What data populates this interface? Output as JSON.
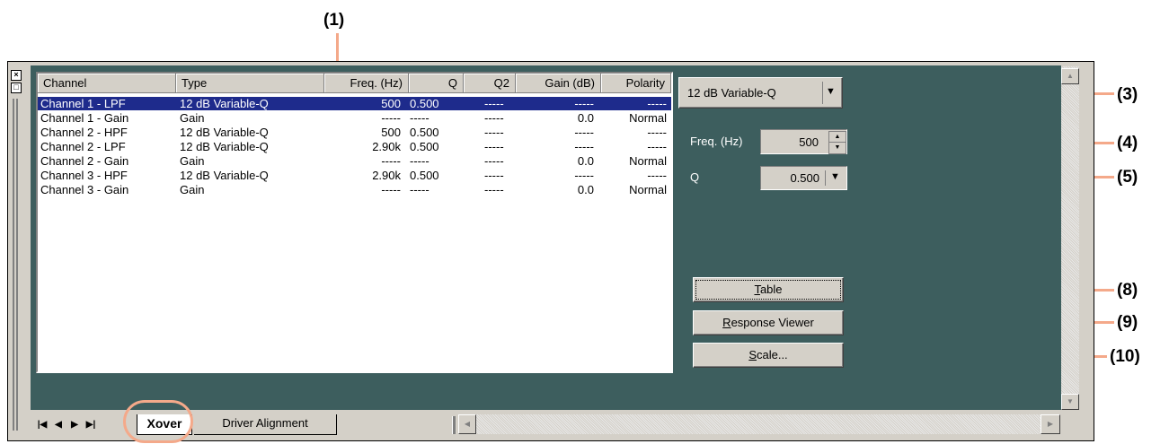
{
  "callouts": {
    "c1": "(1)",
    "c3": "(3)",
    "c4": "(4)",
    "c5": "(5)",
    "c8": "(8)",
    "c9": "(9)",
    "c10": "(10)"
  },
  "list": {
    "headers": [
      "Channel",
      "Type",
      "Freq. (Hz)",
      "Q",
      "Q2",
      "Gain (dB)",
      "Polarity"
    ],
    "rows": [
      {
        "channel": "Channel 1 - LPF",
        "type": "12 dB Variable-Q",
        "freq": "500",
        "q": "0.500",
        "q2": "-----",
        "gain": "-----",
        "polarity": "-----",
        "selected": true
      },
      {
        "channel": "Channel 1 - Gain",
        "type": "Gain",
        "freq": "-----",
        "q": "-----",
        "q2": "-----",
        "gain": "0.0",
        "polarity": "Normal"
      },
      {
        "channel": "Channel 2 - HPF",
        "type": "12 dB Variable-Q",
        "freq": "500",
        "q": "0.500",
        "q2": "-----",
        "gain": "-----",
        "polarity": "-----"
      },
      {
        "channel": "Channel 2 - LPF",
        "type": "12 dB Variable-Q",
        "freq": "2.90k",
        "q": "0.500",
        "q2": "-----",
        "gain": "-----",
        "polarity": "-----"
      },
      {
        "channel": "Channel 2 - Gain",
        "type": "Gain",
        "freq": "-----",
        "q": "-----",
        "q2": "-----",
        "gain": "0.0",
        "polarity": "Normal"
      },
      {
        "channel": "Channel 3 - HPF",
        "type": "12 dB Variable-Q",
        "freq": "2.90k",
        "q": "0.500",
        "q2": "-----",
        "gain": "-----",
        "polarity": "-----"
      },
      {
        "channel": "Channel 3 - Gain",
        "type": "Gain",
        "freq": "-----",
        "q": "-----",
        "q2": "-----",
        "gain": "0.0",
        "polarity": "Normal"
      }
    ]
  },
  "controls": {
    "filter_type": "12 dB Variable-Q",
    "freq_label": "Freq. (Hz)",
    "freq_value": "500",
    "q_label": "Q",
    "q_value": "0.500",
    "table_prefix": "T",
    "table_rest": "able",
    "response_prefix": "R",
    "response_rest": "esponse Viewer",
    "scale_prefix": "S",
    "scale_rest": "cale..."
  },
  "tabs": [
    {
      "label": "Xover",
      "active": true
    },
    {
      "label": "Driver Alignment",
      "active": false
    }
  ],
  "colors": {
    "panel_bg": "#3d5e5e",
    "selection": "#1e2b8c",
    "callout_line": "#f4a98a"
  }
}
